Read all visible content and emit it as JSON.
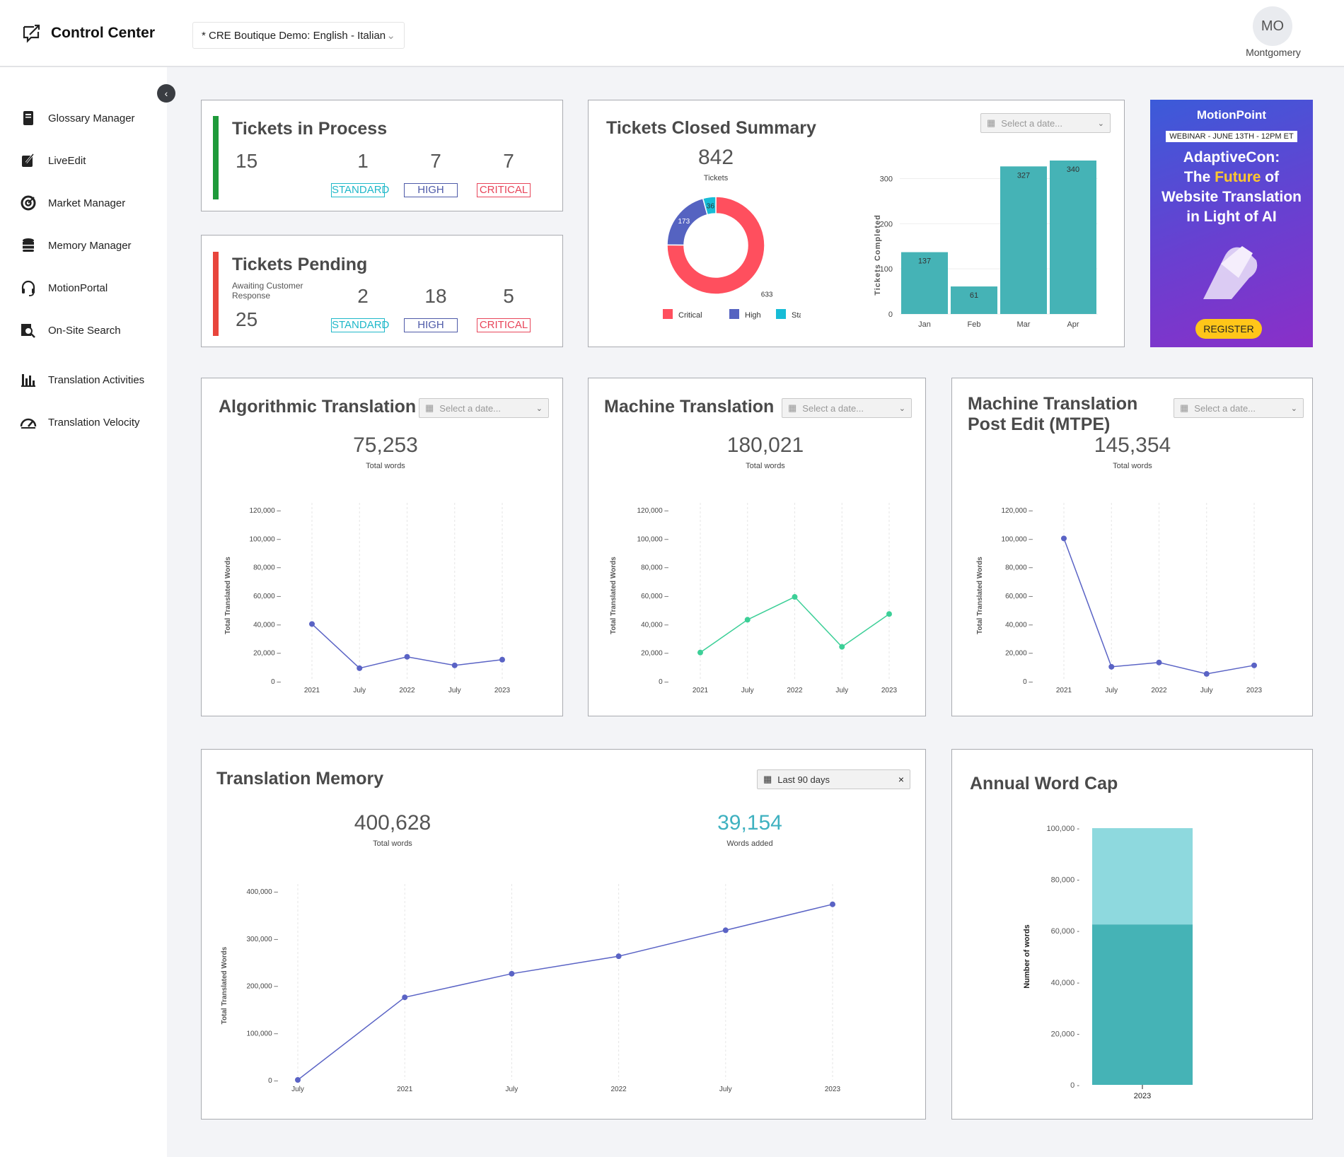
{
  "header": {
    "app_title": "Control Center",
    "project_select": "* CRE Boutique Demo: English - Italian",
    "avatar_initials": "MO",
    "user_name": "Montgomery"
  },
  "sidebar": {
    "items": [
      {
        "label": "Glossary Manager",
        "icon": "book-icon"
      },
      {
        "label": "LiveEdit",
        "icon": "edit-icon"
      },
      {
        "label": "Market Manager",
        "icon": "target-icon"
      },
      {
        "label": "Memory Manager",
        "icon": "database-icon"
      },
      {
        "label": "MotionPortal",
        "icon": "headset-icon"
      },
      {
        "label": "On-Site Search",
        "icon": "search-icon"
      },
      {
        "label": "Translation Activities",
        "icon": "bar-chart-icon"
      },
      {
        "label": "Translation Velocity",
        "icon": "gauge-icon"
      }
    ]
  },
  "colors": {
    "standard": "#1fb8c9",
    "high": "#4e5aa8",
    "critical": "#e8455a",
    "in_process_accent": "#1e9a3a",
    "pending_accent": "#e8453c",
    "teal": "#45b3b6",
    "light_teal": "#8ed9de",
    "line_blue": "#5a63c5",
    "line_green": "#3ccf97"
  },
  "tickets_in_process": {
    "title": "Tickets in Process",
    "total": "15",
    "standard": "1",
    "high": "7",
    "critical": "7",
    "standard_label": "STANDARD",
    "high_label": "HIGH",
    "critical_label": "CRITICAL"
  },
  "tickets_pending": {
    "title": "Tickets Pending",
    "subtitle": "Awaiting Customer Response",
    "total": "25",
    "standard": "2",
    "high": "18",
    "critical": "5",
    "standard_label": "STANDARD",
    "high_label": "HIGH",
    "critical_label": "CRITICAL"
  },
  "tickets_closed": {
    "title": "Tickets Closed Summary",
    "date_placeholder": "Select a date...",
    "total": "842",
    "total_label": "Tickets"
  },
  "ad": {
    "brand": "MotionPoint",
    "webinar": "WEBINAR - JUNE 13TH - 12PM ET",
    "line1": "AdaptiveCon:",
    "line2a": "The ",
    "line2b": "Future",
    "line2c": " of",
    "line3": "Website Translation",
    "line4": "in Light of AI",
    "cta": "REGISTER"
  },
  "algorithmic": {
    "title": "Algorithmic Translation",
    "date_placeholder": "Select a date...",
    "total": "75,253",
    "total_label": "Total words"
  },
  "machine": {
    "title": "Machine Translation",
    "date_placeholder": "Select a date...",
    "total": "180,021",
    "total_label": "Total words"
  },
  "mtpe": {
    "title": "Machine Translation Post Edit (MTPE)",
    "date_placeholder": "Select a date...",
    "total": "145,354",
    "total_label": "Total words"
  },
  "memory": {
    "title": "Translation Memory",
    "date_range": "Last 90 days",
    "total": "400,628",
    "total_label": "Total words",
    "added": "39,154",
    "added_label": "Words added"
  },
  "word_cap": {
    "title": "Annual Word Cap"
  },
  "chart_data": [
    {
      "id": "donut",
      "type": "pie",
      "categories": [
        "Critical",
        "High",
        "Standard"
      ],
      "values": [
        633,
        173,
        36
      ],
      "colors": [
        "#ff4f5e",
        "#5563c1",
        "#17bcd6"
      ],
      "legend": "bottom"
    },
    {
      "id": "closed_bar",
      "type": "bar",
      "categories": [
        "Jan",
        "Feb",
        "Mar",
        "Apr"
      ],
      "values": [
        137,
        61,
        327,
        340
      ],
      "ylabel": "Tickets Completed",
      "ylim": [
        0,
        340
      ],
      "yticks": [
        0,
        100,
        200,
        300
      ],
      "color": "#45b3b6",
      "grid": true
    },
    {
      "id": "alg_line",
      "type": "line",
      "x": [
        "2021",
        "July",
        "2022",
        "July",
        "2023"
      ],
      "values": [
        40000,
        9000,
        17000,
        11000,
        15000
      ],
      "ylabel": "Total Translated Words",
      "ylim": [
        0,
        120000
      ],
      "yticks": [
        0,
        20000,
        40000,
        60000,
        80000,
        100000,
        120000
      ],
      "color": "#5a63c5"
    },
    {
      "id": "mt_line",
      "type": "line",
      "x": [
        "2021",
        "July",
        "2022",
        "July",
        "2023"
      ],
      "values": [
        20000,
        43000,
        59000,
        24000,
        47000
      ],
      "ylabel": "Total Translated Words",
      "ylim": [
        0,
        120000
      ],
      "yticks": [
        0,
        20000,
        40000,
        60000,
        80000,
        100000,
        120000
      ],
      "color": "#3ccf97"
    },
    {
      "id": "mtpe_line",
      "type": "line",
      "x": [
        "2021",
        "July",
        "2022",
        "July",
        "2023"
      ],
      "values": [
        100000,
        10000,
        13000,
        5000,
        11000
      ],
      "ylabel": "Total Translated Words",
      "ylim": [
        0,
        120000
      ],
      "yticks": [
        0,
        20000,
        40000,
        60000,
        80000,
        100000,
        120000
      ],
      "color": "#5a63c5"
    },
    {
      "id": "tm_line",
      "type": "line",
      "x": [
        "July",
        "2021",
        "July",
        "2022",
        "July",
        "2023"
      ],
      "values": [
        0,
        175000,
        225000,
        262000,
        317000,
        372000
      ],
      "ylabel": "Total Translated Words",
      "ylim": [
        0,
        400000
      ],
      "yticks": [
        0,
        100000,
        200000,
        300000,
        400000
      ],
      "color": "#5a63c5"
    },
    {
      "id": "cap_bar",
      "type": "bar",
      "categories": [
        "2023"
      ],
      "series": [
        {
          "values": [
            62500
          ],
          "color": "#45b3b6"
        },
        {
          "values": [
            37500
          ],
          "color": "#8ed9de"
        }
      ],
      "stacked": true,
      "ylabel": "Number of words",
      "ylim": [
        0,
        100000
      ],
      "yticks": [
        0,
        20000,
        40000,
        60000,
        80000,
        100000
      ]
    }
  ]
}
